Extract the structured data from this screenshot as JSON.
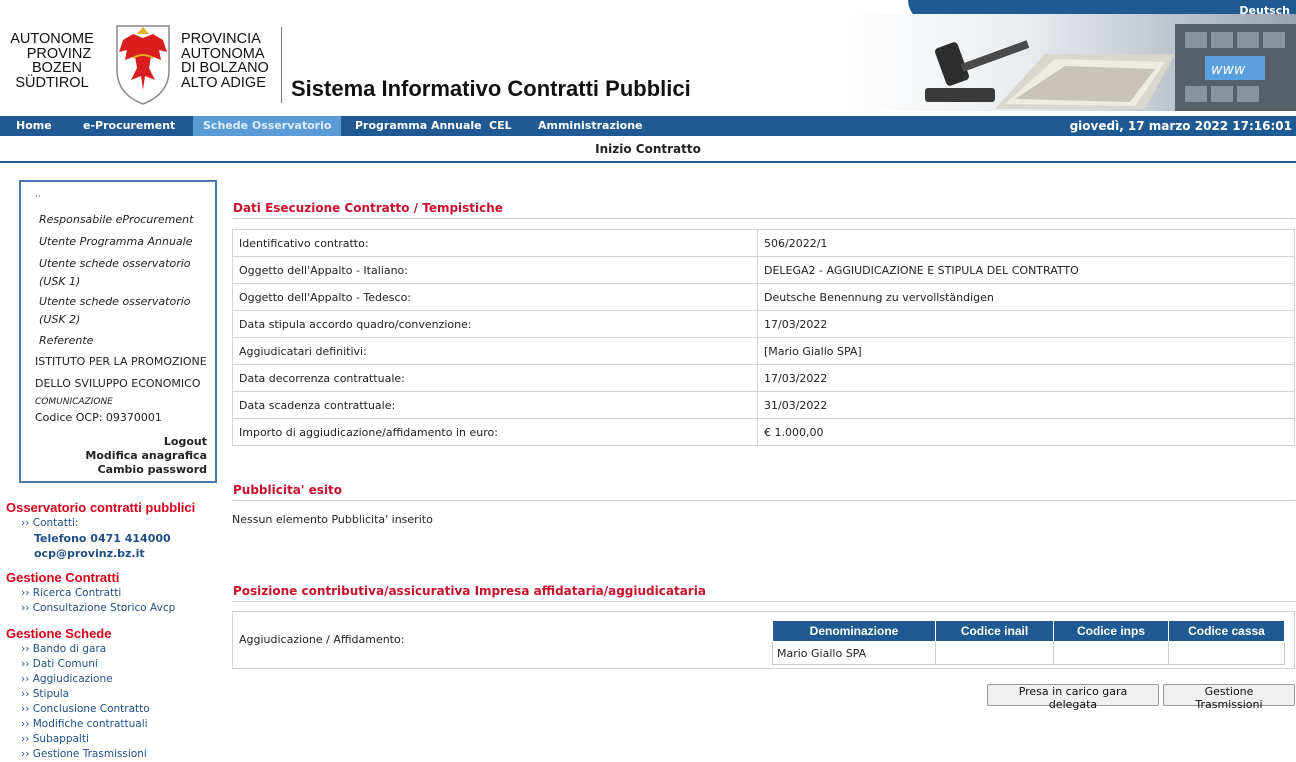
{
  "header": {
    "language": "Deutsch",
    "logo_de": [
      "AUTONOME",
      "PROVINZ",
      "BOZEN",
      "SÜDTIROL"
    ],
    "logo_it": [
      "PROVINCIA",
      "AUTONOMA",
      "DI BOLZANO",
      "ALTO ADIGE"
    ],
    "site_title": "Sistema Informativo Contratti Pubblici"
  },
  "nav": {
    "items": [
      "Home",
      "e-Procurement",
      "Schede Osservatorio",
      "Programma Annuale",
      "CEL",
      "Amministrazione"
    ],
    "active": "Schede Osservatorio",
    "datetime": "giovedì, 17 marzo 2022 17:16:01"
  },
  "page_title": "Inizio Contratto",
  "user_box": {
    "roles": [
      "Responsabile eProcurement",
      "Utente Programma Annuale",
      "Utente schede osservatorio (USK 1)",
      "Utente schede osservatorio (USK 2)",
      "Referente"
    ],
    "org": [
      "ISTITUTO PER LA PROMOZIONE",
      "DELLO SVILUPPO ECONOMICO"
    ],
    "org_sub": "COMUNICAZIONE",
    "ocp_code": "Codice OCP: 09370001",
    "logout": "Logout",
    "modifica": "Modifica anagrafica",
    "cambio": "Cambio password"
  },
  "sidebar": {
    "osservatorio": {
      "title": "Osservatorio contratti pubblici",
      "contatti": "Contatti:",
      "telefono": "Telefono 0471 414000",
      "email": "ocp@provinz.bz.it"
    },
    "gestione_contratti": {
      "title": "Gestione Contratti",
      "items": [
        "Ricerca Contratti",
        "Consultazione Storico Avcp"
      ]
    },
    "gestione_schede": {
      "title": "Gestione Schede",
      "items": [
        "Bando di gara",
        "Dati Comuni",
        "Aggiudicazione",
        "Stipula",
        "Conclusione Contratto",
        "Modifiche contrattuali",
        "Subappalti",
        "Gestione Trasmissioni"
      ]
    }
  },
  "dati": {
    "title": "Dati Esecuzione Contratto / Tempistiche",
    "rows": [
      {
        "label": "Identificativo contratto:",
        "value": "506/2022/1"
      },
      {
        "label": "Oggetto dell'Appalto - Italiano:",
        "value": "DELEGA2 - AGGIUDICAZIONE E STIPULA DEL CONTRATTO"
      },
      {
        "label": "Oggetto dell'Appalto - Tedesco:",
        "value": "Deutsche Benennung zu vervollständigen"
      },
      {
        "label": "Data stipula accordo quadro/convenzione:",
        "value": "17/03/2022"
      },
      {
        "label": "Aggiudicatari definitivi:",
        "value": "[Mario Giallo SPA]"
      },
      {
        "label": "Data decorrenza contrattuale:",
        "value": "17/03/2022"
      },
      {
        "label": "Data scadenza contrattuale:",
        "value": "31/03/2022"
      },
      {
        "label": "Importo di aggiudicazione/affidamento in euro:",
        "value": "€ 1.000,00"
      }
    ]
  },
  "pubblicita": {
    "title": "Pubblicita' esito",
    "empty": "Nessun elemento Pubblicita' inserito"
  },
  "posizione": {
    "title": "Posizione contributiva/assicurativa Impresa affidataria/aggiudicataria",
    "label": "Aggiudicazione / Affidamento:",
    "headers": [
      "Denominazione",
      "Codice inail",
      "Codice inps",
      "Codice cassa"
    ],
    "row": [
      "Mario Giallo SPA",
      "",
      "",
      ""
    ]
  },
  "buttons": {
    "presa": "Presa in carico gara delegata",
    "trasmissioni": "Gestione Trasmissioni"
  }
}
